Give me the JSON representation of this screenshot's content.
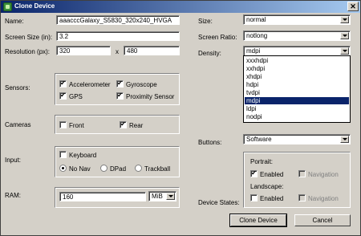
{
  "window": {
    "title": "Clone Device",
    "close_label": "✕"
  },
  "left": {
    "name_label": "Name:",
    "name_value": "aaacccGalaxy_S5830_320x240_HVGA",
    "screen_size_label": "Screen Size (in):",
    "screen_size_value": "3.2",
    "resolution_label": "Resolution (px):",
    "resolution_w": "320",
    "resolution_x": "x",
    "resolution_h": "480",
    "sensors_label": "Sensors:",
    "sensors": {
      "accelerometer": "Accelerometer",
      "gyroscope": "Gyroscope",
      "gps": "GPS",
      "proximity": "Proximity Sensor"
    },
    "cameras_label": "Cameras",
    "cameras": {
      "front": "Front",
      "rear": "Rear"
    },
    "input_label": "Input:",
    "input": {
      "keyboard": "Keyboard",
      "nonav": "No Nav",
      "dpad": "DPad",
      "trackball": "Trackball"
    },
    "ram_label": "RAM:",
    "ram_value": "160",
    "ram_unit": "MiB"
  },
  "right": {
    "size_label": "Size:",
    "size_value": "normal",
    "ratio_label": "Screen Ratio:",
    "ratio_value": "notlong",
    "density_label": "Density:",
    "density_value": "mdpi",
    "density_options": [
      "xxxhdpi",
      "xxhdpi",
      "xhdpi",
      "hdpi",
      "tvdpi",
      "mdpi",
      "ldpi",
      "nodpi"
    ],
    "density_selected_index": 5,
    "buttons_label": "Buttons:",
    "buttons_value": "Software",
    "device_states_label": "Device States:",
    "portrait_label": "Portrait:",
    "landscape_label": "Landscape:",
    "enabled_label": "Enabled",
    "navigation_label": "Navigation"
  },
  "buttons": {
    "clone": "Clone Device",
    "cancel": "Cancel"
  },
  "checkmark": "✔"
}
